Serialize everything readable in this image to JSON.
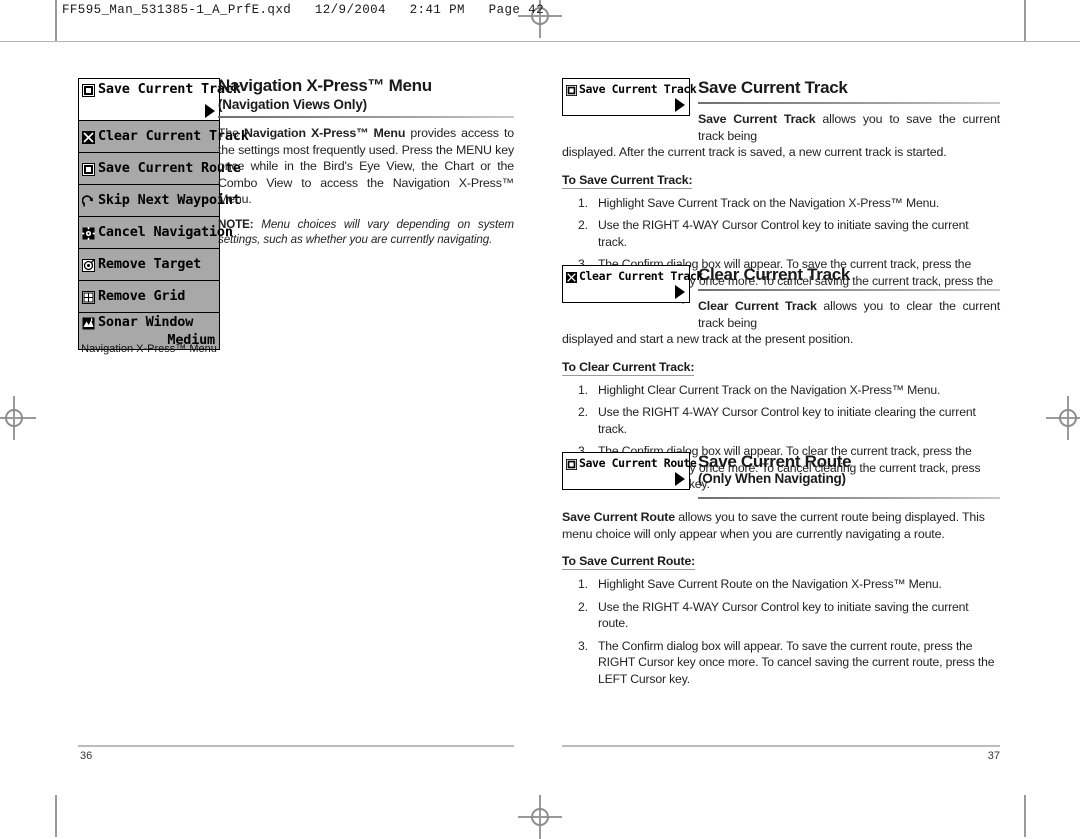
{
  "slug": "FF595_Man_531385-1_A_PrfE.qxd   12/9/2004   2:41 PM   Page 42",
  "folio": {
    "left": "36",
    "right": "37"
  },
  "left_page": {
    "menu_widget": {
      "caption": "Navigation X-Press™ Menu",
      "items": [
        {
          "label": "Save Current Track",
          "icon": "save-disk-icon",
          "selected": true,
          "arrow": true
        },
        {
          "label": "Clear Current Track",
          "icon": "x-box-icon",
          "selected": false,
          "arrow": false
        },
        {
          "label": "Save Current Route",
          "icon": "save-disk-icon",
          "selected": false,
          "arrow": false
        },
        {
          "label": "Skip Next Waypoint",
          "icon": "skip-arrow-icon",
          "selected": false,
          "arrow": false
        },
        {
          "label": "Cancel Navigation",
          "icon": "cancel-nav-icon",
          "selected": false,
          "arrow": false
        },
        {
          "label": "Remove Target",
          "icon": "target-eye-icon",
          "selected": false,
          "arrow": false
        },
        {
          "label": "Remove Grid",
          "icon": "grid-icon",
          "selected": false,
          "arrow": false
        },
        {
          "label": "Sonar Window",
          "icon": "sonar-window-icon",
          "selected": false,
          "arrow": false,
          "value": "Medium"
        }
      ]
    },
    "title": "Navigation X-Press™ Menu",
    "subtitle": "(Navigation Views Only)",
    "body_html": "The <b>Navigation X-Press™ Menu</b> provides access to the settings most frequently used.  Press the MENU key once while in the Bird's Eye View, the Chart or the Combo View to access the Navigation X-Press™ Menu.",
    "note_html": "<b>NOTE:</b>  Menu choices will vary depending on system settings, such as whether you are currently navigating."
  },
  "right_page": {
    "sections": [
      {
        "chip_label": "Save Current Track",
        "chip_icon": "save-disk-icon",
        "title": "Save Current Track",
        "title_sub": "",
        "lead_html": "<b>Save Current Track</b> allows you to save the current track being",
        "cont_html": "displayed. After the current track is saved, a new current track is started.",
        "to_head": "To Save Current Track:",
        "steps": [
          "Highlight Save Current Track on the Navigation X-Press™ Menu.",
          "Use the RIGHT 4-WAY Cursor Control key to initiate saving the current track.",
          "The Confirm dialog box will appear. To save the current track,  press the RIGHT Cursor key once more. To cancel saving the current track, press the LEFT Cursor key."
        ]
      },
      {
        "chip_label": "Clear Current Track",
        "chip_icon": "x-box-icon",
        "title": "Clear Current Track",
        "title_sub": "",
        "lead_html": "<b>Clear Current Track</b> allows you to clear the current track being",
        "cont_html": "displayed and start a new track at the present position.",
        "to_head": "To Clear Current Track:",
        "steps": [
          "Highlight Clear Current Track on the Navigation X-Press™ Menu.",
          "Use the RIGHT 4-WAY Cursor Control key to initiate clearing the current track.",
          "The Confirm dialog box will appear. To clear the current track,  press the RIGHT Cursor key once more. To cancel clearing the current track, press the LEFT Cursor key."
        ]
      },
      {
        "chip_label": "Save Current Route",
        "chip_icon": "save-disk-icon",
        "title": "Save Current Route",
        "title_sub": "(Only When Navigating)",
        "lead_html": "",
        "cont_html": "<b>Save Current Route</b> allows you to save the current route being displayed. This menu choice will only appear when you are currently navigating a route.",
        "to_head": "To Save Current Route:",
        "steps": [
          "Highlight Save Current Route on the Navigation X-Press™ Menu.",
          "Use the RIGHT 4-WAY Cursor Control key to initiate saving the current route.",
          "The Confirm dialog box will appear. To save the current route,  press the RIGHT Cursor key once more. To cancel saving the current route, press the LEFT Cursor key."
        ]
      }
    ]
  },
  "colors": {
    "menu_bg": "#a8a8a8",
    "menu_selected_bg": "#ffffff",
    "ink": "#231f20",
    "rule": "#9a9a9a"
  }
}
